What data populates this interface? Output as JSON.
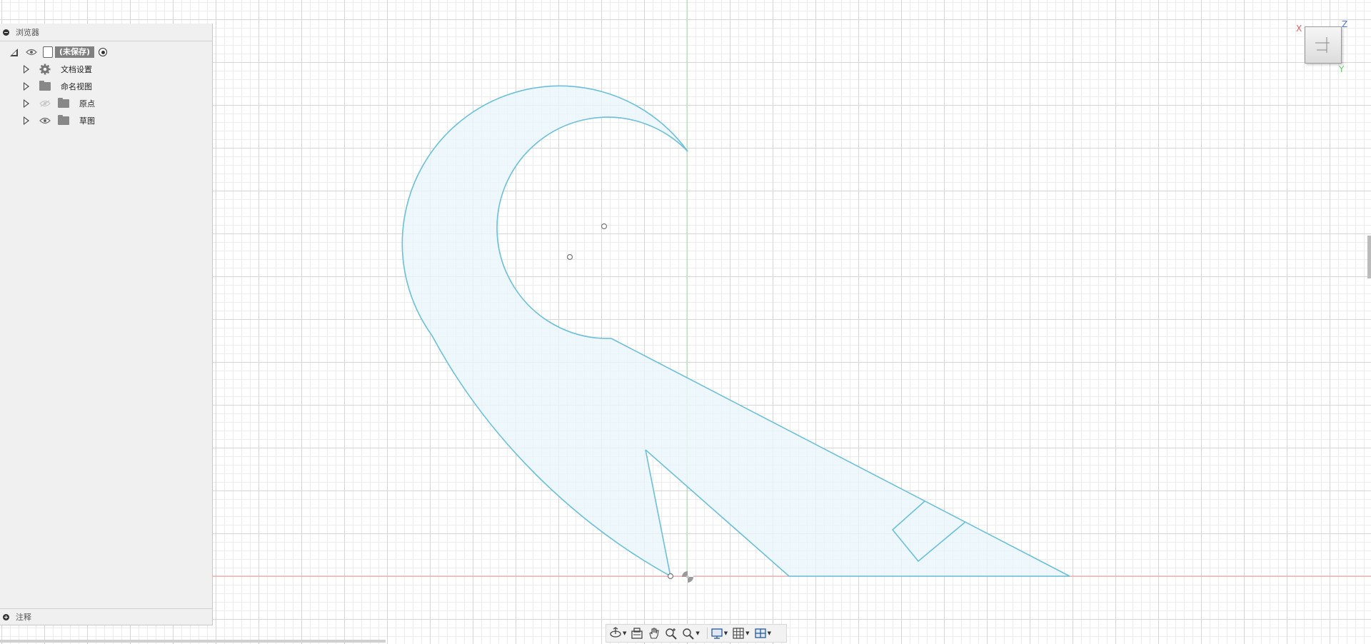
{
  "browser": {
    "title": "浏览器",
    "root": {
      "label": "(未保存)"
    },
    "items": [
      {
        "label": "文档设置",
        "icon": "gear-icon",
        "visibility": "none"
      },
      {
        "label": "命名视图",
        "icon": "folder-icon",
        "visibility": "none"
      },
      {
        "label": "原点",
        "icon": "folder-icon",
        "visibility": "hidden"
      },
      {
        "label": "草图",
        "icon": "folder-icon",
        "visibility": "visible"
      }
    ],
    "footer_label": "注释"
  },
  "viewcube": {
    "x_label": "X",
    "y_label": "Y",
    "z_label": "Z",
    "x_color": "#e06060",
    "y_color": "#66cc66",
    "z_color": "#4a6fe0"
  },
  "toolbar": {
    "buttons": [
      "orbit-icon",
      "look-at-icon",
      "pan-icon",
      "zoom-icon",
      "zoom-window-icon",
      "display-settings-icon",
      "grid-settings-icon",
      "viewports-icon"
    ]
  },
  "colors": {
    "sketch_line": "#6bbfd9",
    "sketch_fill": "#eaf6fb",
    "axis_x": "#ee9a9a",
    "axis_y": "#a9e6a9",
    "grid_minor": "#ececec",
    "grid_major": "#d6d6d6"
  }
}
